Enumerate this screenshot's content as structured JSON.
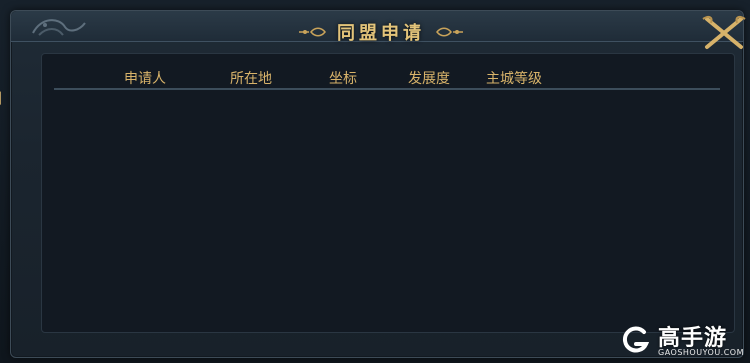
{
  "dialog": {
    "title": "同盟申请",
    "close_icon": "close-icon"
  },
  "table": {
    "columns": [
      "申请人",
      "所在地",
      "坐标",
      "发展度",
      "主城等级"
    ],
    "rows": []
  },
  "watermark": {
    "brand": "高手游",
    "domain": "GAOSHOUYOU.COM"
  },
  "colors": {
    "accent_gold": "#d8b36a",
    "panel_bg": "#1b252f",
    "list_bg": "#121922"
  }
}
